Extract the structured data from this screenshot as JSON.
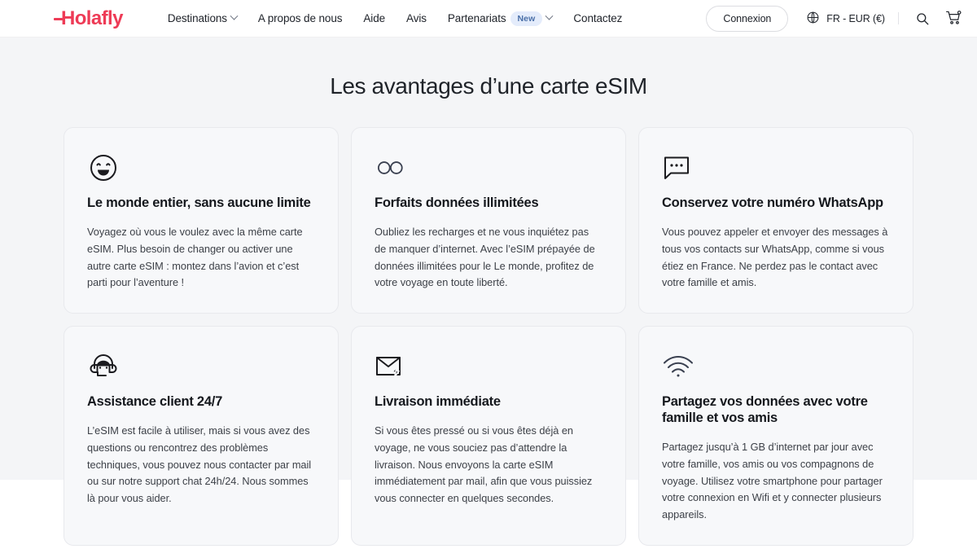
{
  "header": {
    "logo_text": "Holafly",
    "nav": [
      {
        "label": "Destinations",
        "has_chevron": true,
        "badge": null
      },
      {
        "label": "A propos de nous",
        "has_chevron": false,
        "badge": null
      },
      {
        "label": "Aide",
        "has_chevron": false,
        "badge": null
      },
      {
        "label": "Avis",
        "has_chevron": false,
        "badge": null
      },
      {
        "label": "Partenariats",
        "has_chevron": true,
        "badge": "New"
      },
      {
        "label": "Contactez",
        "has_chevron": false,
        "badge": null
      }
    ],
    "login_label": "Connexion",
    "locale_label": "FR - EUR (€)",
    "icons": {
      "globe": "globe-icon",
      "search": "search-icon",
      "cart": "cart-icon"
    },
    "brand_color": "#ee3b56",
    "badge_bg": "#e4ecfb",
    "badge_color": "#4a6fa8"
  },
  "section": {
    "title": "Les avantages d’une carte eSIM",
    "background": "#f4f5f7",
    "cards": [
      {
        "icon": "smiley-face-icon",
        "title": "Le monde entier, sans aucune limite",
        "text": "Voyagez où vous le voulez avec la même carte eSIM. Plus besoin de changer ou activer une autre carte eSIM : montez dans l’avion et c’est parti pour l’aventure !"
      },
      {
        "icon": "infinity-icon",
        "title": "Forfaits données illimitées",
        "text": "Oubliez les recharges et ne vous inquiétez pas de manquer d’internet. Avec l’eSIM prépayée de données illimitées pour le Le monde, profitez de votre voyage en toute liberté."
      },
      {
        "icon": "chat-bubble-icon",
        "title": "Conservez votre numéro WhatsApp",
        "text": "Vous pouvez appeler et envoyer des messages à tous vos contacts sur WhatsApp, comme si vous étiez en France. Ne perdez pas le contact avec votre famille et amis."
      },
      {
        "icon": "headset-support-icon",
        "title": "Assistance client 24/7",
        "text": "L’eSIM est facile à utiliser, mais si vous avez des questions ou rencontrez des problèmes techniques, vous pouvez nous contacter par mail ou sur notre support chat 24h/24. Nous sommes là pour vous aider."
      },
      {
        "icon": "envelope-bolt-icon",
        "title": "Livraison immédiate",
        "text": "Si vous êtes pressé ou si vous êtes déjà en voyage, ne vous souciez pas d’attendre la livraison. Nous envoyons la carte eSIM immédiatement par mail, afin que vous puissiez vous connecter en quelques secondes."
      },
      {
        "icon": "wifi-icon",
        "title": "Partagez vos données avec votre famille et vos amis",
        "text": "Partagez jusqu’à 1 GB d’internet par jour avec votre famille, vos amis ou vos compagnons de voyage. Utilisez votre smartphone pour partager votre connexion en Wifi et y connecter plusieurs appareils."
      }
    ]
  }
}
